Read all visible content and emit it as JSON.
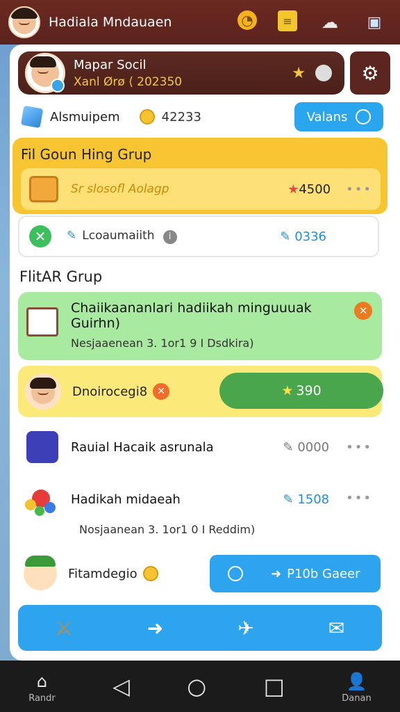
{
  "topbar": {
    "title": "Hadiala Mndauaen",
    "icons": [
      "timer-icon",
      "ledger-icon",
      "cloud-icon",
      "box-icon"
    ]
  },
  "profile": {
    "name": "Mapar Socil",
    "subtitle": "Xanl Ørø ⟨ 202350"
  },
  "resources": {
    "label": "Alsmuipem",
    "coin_value": "42233",
    "button_label": "Valans"
  },
  "gold_section": {
    "title": "Fil Goun Hing Grup",
    "item_text": "Sr slosofl Aolagp",
    "item_value": "4500",
    "more": "•••"
  },
  "status_row": {
    "text": "Lcoaumaiith",
    "value": "0336"
  },
  "group_section": {
    "title": "FlitAR Grup"
  },
  "challenge": {
    "title": "Chaiikaananlari hadiikah minguuuak Guirhn)",
    "subtitle": "Nesjaaenean 3.  1or1 9 I Dsdkira)"
  },
  "player_row": {
    "name": "Dnoirocegi8",
    "score": "390"
  },
  "list_items": [
    {
      "title": "Rauial Hacaik asrunala",
      "value": "0000",
      "more": "•••"
    },
    {
      "title": "Hadikah midaeah",
      "value": "1508",
      "subtitle": "Nosjaanean 3.  1or1 0 I Reddim)",
      "more": "•••"
    }
  ],
  "bottom_row": {
    "name": "Fitamdegio",
    "button_label": "P10b Gaeer"
  },
  "navbar": {
    "left_label": "Randr",
    "right_label": "Danan"
  },
  "colors": {
    "topbar": "#6b2a22",
    "gold": "#f7c531",
    "green_card": "#a8ea9f",
    "yellow_card": "#fbe97a",
    "blue": "#2ea4ef"
  }
}
